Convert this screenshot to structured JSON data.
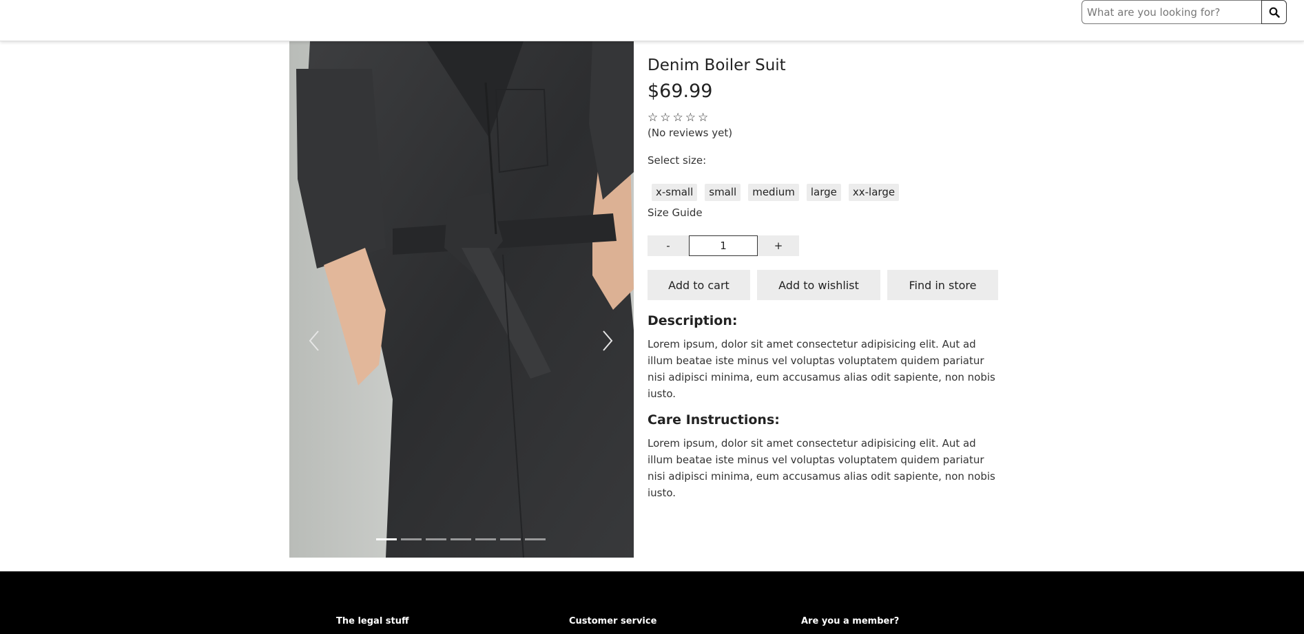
{
  "header": {
    "search": {
      "placeholder": "What are you looking for?",
      "value": ""
    }
  },
  "gallery": {
    "slide_count": 7,
    "active_index": 0
  },
  "product": {
    "title": "Denim Boiler Suit",
    "price": "$69.99",
    "rating": {
      "stars_filled": 0,
      "stars_total": 5,
      "reviews_text": "(No reviews yet)"
    },
    "select_size_label": "Select size:",
    "sizes": [
      "x-small",
      "small",
      "medium",
      "large",
      "xx-large"
    ],
    "size_guide_label": "Size Guide",
    "quantity": {
      "decrement_label": "-",
      "value": "1",
      "increment_label": "+"
    },
    "actions": {
      "add_to_cart": "Add to cart",
      "add_to_wishlist": "Add to wishlist",
      "find_in_store": "Find in store"
    },
    "description": {
      "heading": "Description:",
      "text": "Lorem ipsum, dolor sit amet consectetur adipisicing elit. Aut ad illum beatae iste minus vel voluptas voluptatem quidem pariatur nisi adipisci minima, eum accusamus alias odit sapiente, non nobis iusto."
    },
    "care": {
      "heading": "Care Instructions:",
      "text": "Lorem ipsum, dolor sit amet consectetur adipisicing elit. Aut ad illum beatae iste minus vel voluptas voluptatem quidem pariatur nisi adipisci minima, eum accusamus alias odit sapiente, non nobis iusto."
    }
  },
  "footer": {
    "columns": [
      "The legal stuff",
      "Customer service",
      "Are you a member?"
    ]
  },
  "colors": {
    "footer_bg": "#000000",
    "button_bg": "#ececec",
    "text": "#222222"
  },
  "icons": {
    "search": "search-icon",
    "prev": "chevron-left-icon",
    "next": "chevron-right-icon",
    "star": "star-outline-icon"
  }
}
